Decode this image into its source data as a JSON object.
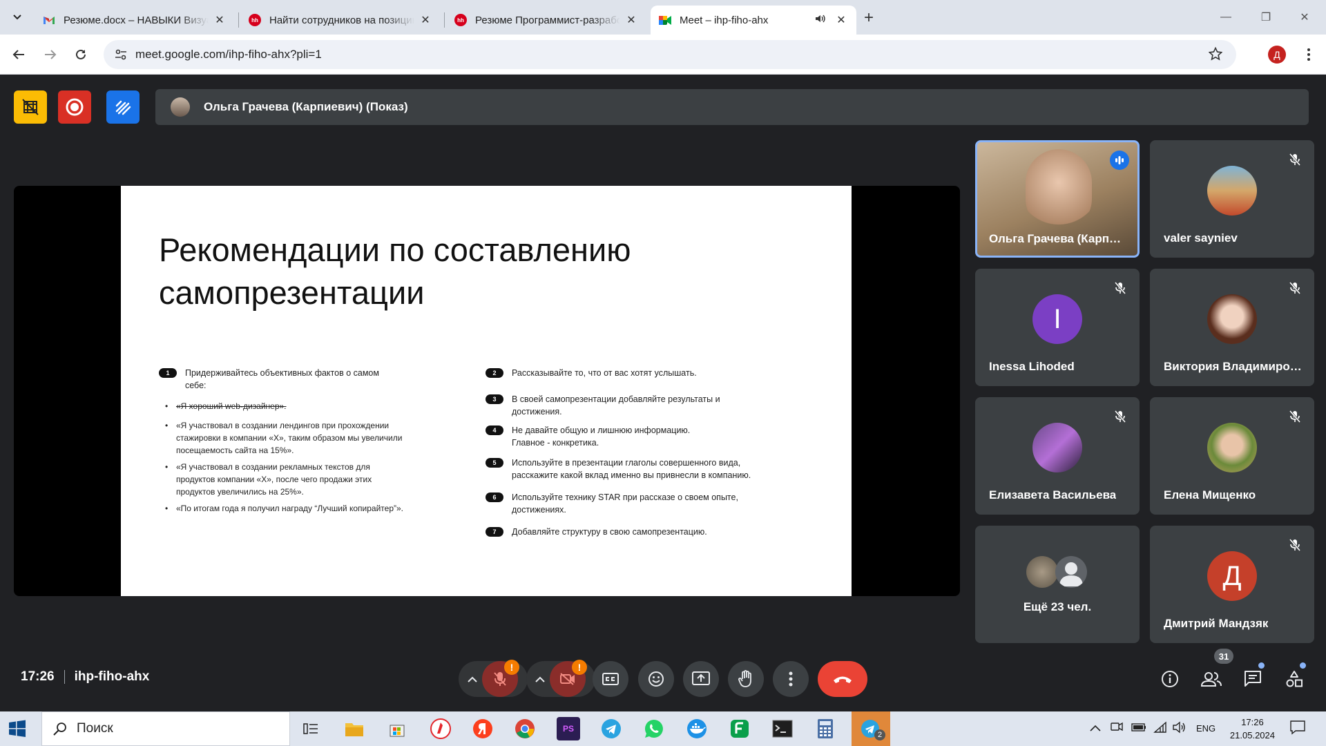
{
  "browser": {
    "tabs": [
      {
        "title": "Резюме.docx – НАВЫКИ Визуал",
        "icon": "gmail-icon",
        "active": false
      },
      {
        "title": "Найти сотрудников на позицию",
        "icon": "hh-icon",
        "active": false
      },
      {
        "title": "Резюме Программист-разработчик",
        "icon": "hh-icon",
        "active": false
      },
      {
        "title": "Meet – ihp-fiho-ahx",
        "icon": "meet-icon",
        "active": true
      }
    ],
    "hh_label": "hh",
    "url": "meet.google.com/ihp-fiho-ahx?pli=1",
    "profile_initial": "Д"
  },
  "meet": {
    "presenter_bar": "Ольга Грачева (Карпиевич) (Показ)",
    "slide": {
      "title": "Рекомендации по составлению самопрезентации",
      "left_items": [
        {
          "num": "1",
          "text": "Придерживайтесь объективных фактов о самом себе:"
        }
      ],
      "bullets": [
        {
          "text": "«Я хороший web-дизайнер».",
          "strike": true
        },
        {
          "text": "«Я участвовал в создании лендингов при прохождении стажировки в компании «Х», таким образом мы увеличили посещаемость сайта на 15%».",
          "strike": false
        },
        {
          "text": "«Я участвовал в создании рекламных текстов для продуктов компании «Х», после чего продажи этих продуктов увеличились на 25%».",
          "strike": false
        },
        {
          "text": "«По итогам года я получил награду “Лучший копирайтер”».",
          "strike": false
        }
      ],
      "right_items": [
        {
          "num": "2",
          "text": "Рассказывайте то, что от вас хотят услышать."
        },
        {
          "num": "3",
          "text": "В своей самопрезентации добавляйте результаты и достижения."
        },
        {
          "num": "4",
          "text": "Не давайте общую и лишнюю информацию. Главное - конкретика."
        },
        {
          "num": "5",
          "text": "Используйте в презентации глаголы совершенного вида, расскажите какой вклад именно вы привнесли в компанию."
        },
        {
          "num": "6",
          "text": "Используйте технику STAR при рассказе о своем опыте, достижениях."
        },
        {
          "num": "7",
          "text": "Добавляйте структуру в свою самопрезентацию."
        }
      ]
    },
    "participants": [
      {
        "name": "Ольга Грачева (Карпиевич)",
        "state": "speaking"
      },
      {
        "name": "valer sayniev",
        "state": "muted"
      },
      {
        "name": "Inessa Lihoded",
        "state": "muted",
        "initial": "I",
        "color": "#7b3fc4"
      },
      {
        "name": "Виктория Владимировна",
        "state": "muted"
      },
      {
        "name": "Елизавета Васильева",
        "state": "muted"
      },
      {
        "name": "Елена Мищенко",
        "state": "muted"
      },
      {
        "name": "Ещё 23 чел.",
        "state": "more"
      },
      {
        "name": "Дмитрий Мандзяк",
        "state": "muted",
        "initial": "Д",
        "color": "#c5402a"
      }
    ],
    "time": "17:26",
    "meeting_code": "ihp-fiho-ahx",
    "participants_count": "31",
    "mic_badge": "!",
    "cam_badge": "!"
  },
  "taskbar": {
    "search_label": "Поиск",
    "lang": "ENG",
    "time": "17:26",
    "date": "21.05.2024",
    "telegram_count": "2",
    "ps_label": "PS"
  },
  "colors": {
    "accent_blue": "#8ab4f8",
    "end_call": "#ea4335",
    "warning": "#f57c00"
  }
}
